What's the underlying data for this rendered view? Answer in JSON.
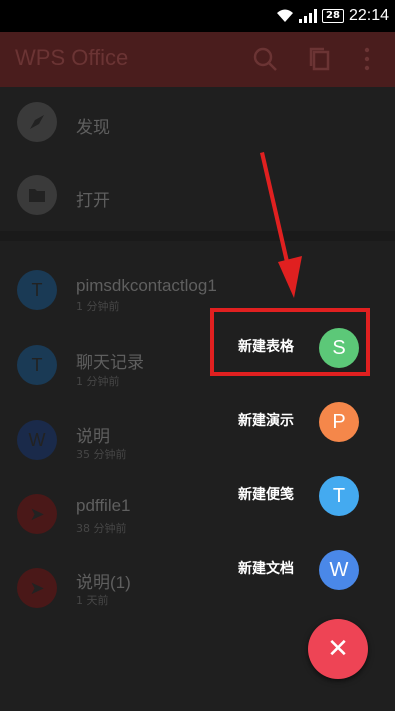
{
  "status_bar": {
    "battery": "28",
    "time": "22:14"
  },
  "app_bar": {
    "title": "WPS Office",
    "icons": [
      "search-icon",
      "copy-icon",
      "more-icon"
    ]
  },
  "nav": [
    {
      "label": "发现",
      "icon": "compass-icon"
    },
    {
      "label": "打开",
      "icon": "folder-icon"
    }
  ],
  "recent_files": [
    {
      "name": "pimsdkcontactlog1",
      "time": "1 分钟前",
      "icon_letter": "T",
      "icon": "text-file-icon",
      "color": "#1a3a55"
    },
    {
      "name": "聊天记录",
      "time": "1 分钟前",
      "icon_letter": "T",
      "icon": "text-file-icon",
      "color": "#1a3a55"
    },
    {
      "name": "说明",
      "time": "35 分钟前",
      "icon_letter": "W",
      "icon": "word-file-icon",
      "color": "#1a2a4a"
    },
    {
      "name": "pdffile1",
      "time": "38 分钟前",
      "icon_letter": "➤",
      "icon": "pdf-file-icon",
      "color": "#4a1818"
    },
    {
      "name": "说明(1)",
      "time": "1 天前",
      "icon_letter": "➤",
      "icon": "pdf-file-icon",
      "color": "#4a1818"
    }
  ],
  "fab_menu": [
    {
      "label": "新建表格",
      "letter": "S",
      "color": "#5cc878",
      "icon": "spreadsheet-icon"
    },
    {
      "label": "新建演示",
      "letter": "P",
      "color": "#f5874a",
      "icon": "presentation-icon"
    },
    {
      "label": "新建便笺",
      "letter": "T",
      "color": "#44aaf0",
      "icon": "note-icon"
    },
    {
      "label": "新建文档",
      "letter": "W",
      "color": "#4a88e8",
      "icon": "document-icon"
    }
  ],
  "close_fab": {
    "symbol": "✕",
    "color": "#ee4455"
  },
  "annotation": {
    "highlight_color": "#e02020",
    "arrow_color": "#e02020"
  }
}
